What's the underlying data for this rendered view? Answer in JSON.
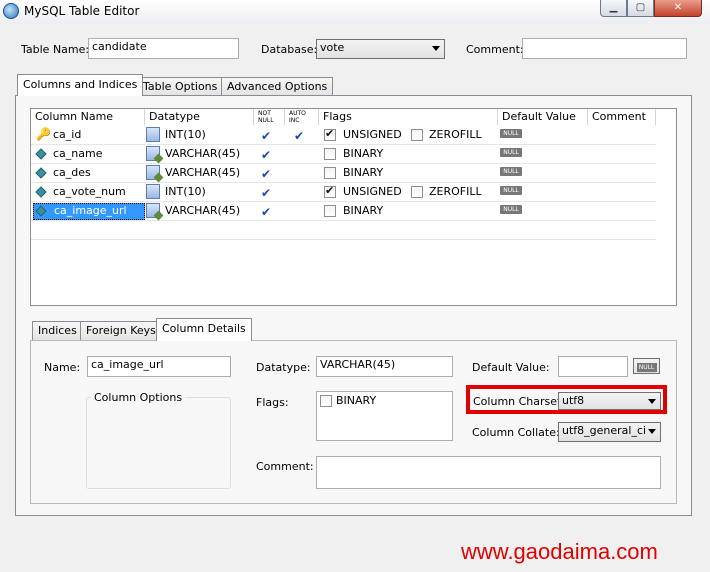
{
  "window": {
    "title": "MySQL Table Editor"
  },
  "form": {
    "table_name_label": "Table Name:",
    "table_name": "candidate",
    "database_label": "Database:",
    "database": "vote",
    "comment_label": "Comment:",
    "comment": ""
  },
  "tabs": [
    "Columns and Indices",
    "Table Options",
    "Advanced Options"
  ],
  "grid": {
    "headers": [
      "Column Name",
      "Datatype",
      "NOT NULL",
      "AUTO INC",
      "Flags",
      "Default Value",
      "Comment"
    ],
    "rows": [
      {
        "name": "ca_id",
        "type": "INT(10)",
        "icon": "key-icon",
        "flags": [
          "UNSIGNED",
          "ZEROFILL"
        ]
      },
      {
        "name": "ca_name",
        "type": "VARCHAR(45)",
        "icon": "column-icon",
        "flags": [
          "BINARY"
        ]
      },
      {
        "name": "ca_des",
        "type": "VARCHAR(45)",
        "icon": "column-icon",
        "flags": [
          "BINARY"
        ]
      },
      {
        "name": "ca_vote_num",
        "type": "INT(10)",
        "icon": "column-icon",
        "flags": [
          "UNSIGNED",
          "ZEROFILL"
        ]
      },
      {
        "name": "ca_image_url",
        "type": "VARCHAR(45)",
        "icon": "column-icon",
        "flags": [
          "BINARY"
        ]
      }
    ],
    "null_badge": "NULL"
  },
  "subtabs": [
    "Indices",
    "Foreign Keys",
    "Column Details"
  ],
  "details": {
    "name_label": "Name:",
    "name": "ca_image_url",
    "datatype_label": "Datatype:",
    "datatype": "VARCHAR(45)",
    "default_label": "Default Value:",
    "default_value": "",
    "null_button": "NULL",
    "column_options_label": "Column Options",
    "flags_label": "Flags:",
    "flag_binary": "BINARY",
    "charset_label": "Column Charset:",
    "charset": "utf8",
    "collate_label": "Column Collate:",
    "collate": "utf8_general_ci",
    "comment_label": "Comment:",
    "comment": ""
  },
  "watermark": "www.gaodaima.com",
  "colors": {
    "highlight": "#e00000",
    "selection": "#3399ff"
  }
}
